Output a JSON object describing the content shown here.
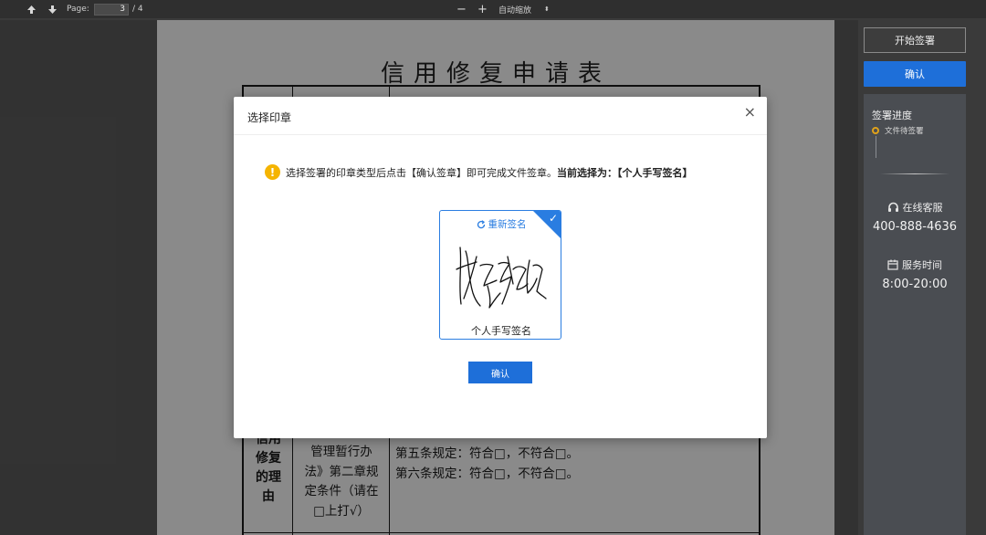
{
  "toolbar": {
    "page_label": "Page:",
    "page_value": "3",
    "page_total": "/ 4",
    "zoom_minus": "−",
    "zoom_plus": "+",
    "zoom_value": "自动缩放",
    "zoom_caret": "⬍"
  },
  "document": {
    "title": "信用修复申请表",
    "left_col": [
      "信用",
      "修复",
      "的理",
      "由"
    ],
    "mid_col": [
      "管理暂行办",
      "法》第二章规",
      "定条件（请在",
      "□上打√）"
    ],
    "right_col": [
      "第五条规定：符合□，不符合□。",
      "第六条规定：符合□，不符合□。"
    ]
  },
  "panel": {
    "start_sign": "开始签署",
    "confirm": "确认",
    "progress_title": "签署进度",
    "progress_item": "文件待签署",
    "service_label": "在线客服",
    "service_phone": "400-888-4636",
    "hours_label": "服务时间",
    "hours_value": "8:00-20:00"
  },
  "modal": {
    "title": "选择印章",
    "close": "×",
    "notice_text": "选择签署的印章类型后点击【确认签章】即可完成文件签章。",
    "notice_bold": "当前选择为：【个人手写签名】",
    "resign": "重新签名",
    "seal_name": "个人手写签名",
    "confirm": "确认"
  },
  "colors": {
    "accent": "#1e6fd9",
    "warning": "#f5b400",
    "progress": "#e0a21a"
  }
}
